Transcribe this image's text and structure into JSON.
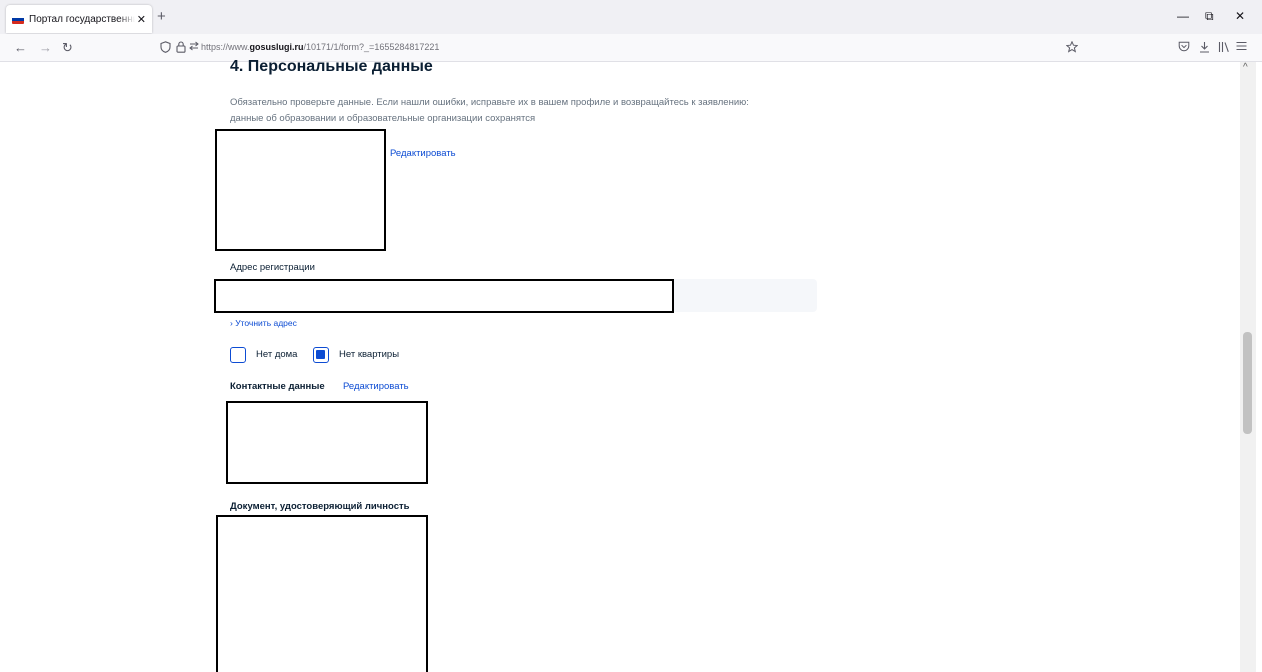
{
  "browser": {
    "tab": {
      "title": "Портал государственных услуг",
      "close": "✕"
    },
    "new_tab": "+",
    "window_controls": {
      "minimize": "—",
      "restore": "⧉",
      "close": "✕"
    },
    "nav": {
      "back": "←",
      "forward": "→",
      "reload": "↻"
    },
    "url": {
      "prefix": "https://www.",
      "domain": "gosuslugi.ru",
      "path": "/10171/1/form?_=1655284817221"
    },
    "icons": {
      "shield": "shield-icon",
      "lock": "lock-icon",
      "permissions": "permissions-icon",
      "bookmark": "star-icon",
      "pocket": "pocket-icon",
      "downloads": "download-icon",
      "library": "library-icon",
      "menu": "hamburger-menu-icon"
    }
  },
  "colors": {
    "accent": "#0d4cd3",
    "text": "#0b1f33",
    "hint": "#66727f",
    "flag_white": "#ffffff",
    "flag_blue": "#0039a6",
    "flag_red": "#d52b1e"
  },
  "section": {
    "title": "4.  Персональные данные",
    "hint_lines": [
      "Обязательно проверьте данные. Если нашли ошибки, исправьте их в вашем профиле и возвращайтесь к заявлению:",
      "данные об образовании и образовательные организации сохранятся"
    ],
    "edit_profile": "Редактировать"
  },
  "address": {
    "label": "Адрес регистрации",
    "clarify": "› Уточнить адрес",
    "no_house": "Нет дома",
    "no_house_checked": false,
    "no_flat": "Нет квартиры",
    "no_flat_checked": true
  },
  "contacts": {
    "label": "Контактные данные",
    "edit": "Редактировать"
  },
  "identity": {
    "label": "Документ, удостоверяющий личность"
  }
}
